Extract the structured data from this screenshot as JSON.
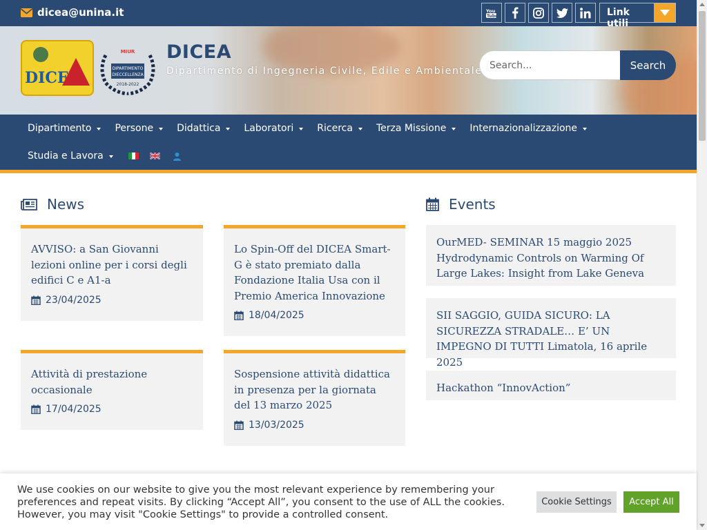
{
  "topbar": {
    "email": "dicea@unina.it",
    "social": [
      "youtube-icon",
      "facebook-icon",
      "instagram-icon",
      "twitter-icon",
      "linkedin-icon"
    ],
    "link_utili": "Link utili"
  },
  "header": {
    "title": "DICEA",
    "subtitle": "Dipartimento di Ingegneria Civile, Edile e Ambientale",
    "logo_text": "DICEA",
    "badge_top": "MIUR",
    "badge_line1": "DIPARTIMENTO",
    "badge_line2": "DIECCELLENZA",
    "badge_years": "2018-2022",
    "search": {
      "placeholder": "Search...",
      "button": "Search"
    }
  },
  "nav": {
    "row1": [
      "Dipartimento",
      "Persone",
      "Didattica",
      "Laboratori",
      "Ricerca",
      "Terza Missione",
      "Internazionalizzazione"
    ],
    "row2": [
      "Studia e Lavora"
    ]
  },
  "news": {
    "title": "News",
    "items": [
      {
        "title": "AVVISO: a San Giovanni lezioni online per i corsi degli edifici C e A1-a",
        "date": "23/04/2025"
      },
      {
        "title": "Lo Spin-Off del DICEA Smart-G è stato premiato dalla Fondazione Italia Usa con il Premio America Innovazione",
        "date": "18/04/2025"
      },
      {
        "title": "Attività di prestazione occasionale",
        "date": "17/04/2025"
      },
      {
        "title": "Sospensione attività didattica in presenza per la giornata del 13 marzo 2025",
        "date": "13/03/2025"
      }
    ]
  },
  "events": {
    "title": "Events",
    "items": [
      "OurMED- SEMINAR 15 maggio 2025 Hydrodynamic Controls on Warming Of Large Lakes: Insight from Lake Geneva",
      "SII SAGGIO, GUIDA SICURO: LA SICUREZZA STRADALE… E’ UN IMPEGNO DI TUTTI Limatola, 16 aprile 2025",
      "Hackathon “InnovAction”"
    ]
  },
  "cookie": {
    "text": "We use cookies on our website to give you the most relevant experience by remembering your preferences and repeat visits. By clicking “Accept All”, you consent to the use of ALL the cookies. However, you may visit \"Cookie Settings\" to provide a controlled consent.",
    "settings": "Cookie Settings",
    "accept": "Accept All"
  },
  "colors": {
    "primary": "#2b4a73",
    "accent": "#f4a62a",
    "card": "#f2f2f2",
    "accept": "#61a229"
  }
}
